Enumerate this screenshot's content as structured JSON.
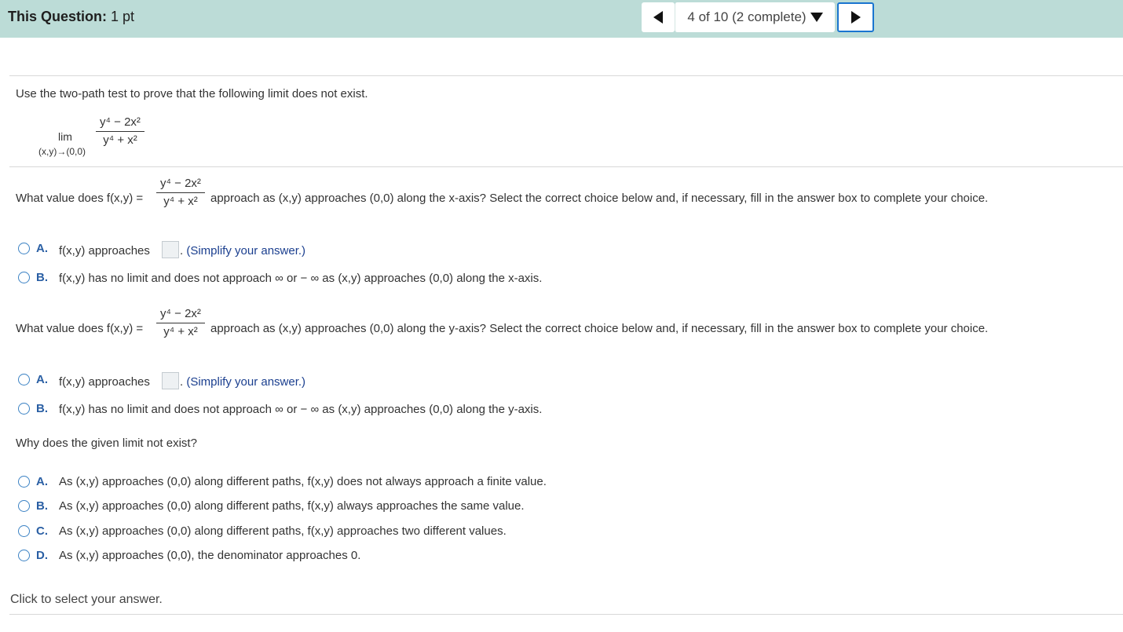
{
  "header": {
    "title_bold": "This Question:",
    "title_rest": " 1 pt",
    "progress": "4 of 10 (2 complete)"
  },
  "intro": "Use the two-path test to prove that the following limit does not exist.",
  "limit": {
    "lim": "lim",
    "sub": "(x,y)→(0,0)",
    "num": "y⁴ − 2x²",
    "den": "y⁴ + x²"
  },
  "q1": {
    "prefix": "What value does f(x,y) =",
    "suffix": "approach as (x,y) approaches (0,0) along the x-axis? Select the correct choice below and, if necessary, fill in the answer box to complete your choice.",
    "a_letter": "A.",
    "a_text": "f(x,y) approaches",
    "a_hint": "(Simplify your answer.)",
    "b_letter": "B.",
    "b_text": "f(x,y) has no limit and does not approach ∞ or − ∞ as (x,y) approaches (0,0) along the x-axis."
  },
  "q2": {
    "prefix": "What value does f(x,y) =",
    "suffix": "approach as (x,y) approaches (0,0) along the y-axis? Select the correct choice below and, if necessary, fill in the answer box to complete your choice.",
    "a_letter": "A.",
    "a_text": "f(x,y) approaches",
    "a_hint": "(Simplify your answer.)",
    "b_letter": "B.",
    "b_text": "f(x,y) has no limit and does not approach ∞ or − ∞ as (x,y) approaches (0,0) along the y-axis."
  },
  "q3": {
    "question": "Why does the given limit not exist?",
    "options": [
      {
        "letter": "A.",
        "text": "As (x,y) approaches (0,0) along different paths, f(x,y) does not always approach a finite value."
      },
      {
        "letter": "B.",
        "text": "As (x,y) approaches (0,0) along different paths, f(x,y) always approaches the same value."
      },
      {
        "letter": "C.",
        "text": "As (x,y) approaches (0,0) along different paths, f(x,y) approaches two different values."
      },
      {
        "letter": "D.",
        "text": "As (x,y) approaches (0,0), the denominator approaches 0."
      }
    ]
  },
  "footer": "Click to select your answer.",
  "icons": {
    "prev": "caret-left-icon",
    "next": "caret-right-icon",
    "dropdown": "caret-down-icon"
  },
  "colors": {
    "header_bg": "#bcdcd7",
    "accent": "#2a5fa4",
    "radio_border": "#3b82c4",
    "hint": "#1b3f8f"
  }
}
